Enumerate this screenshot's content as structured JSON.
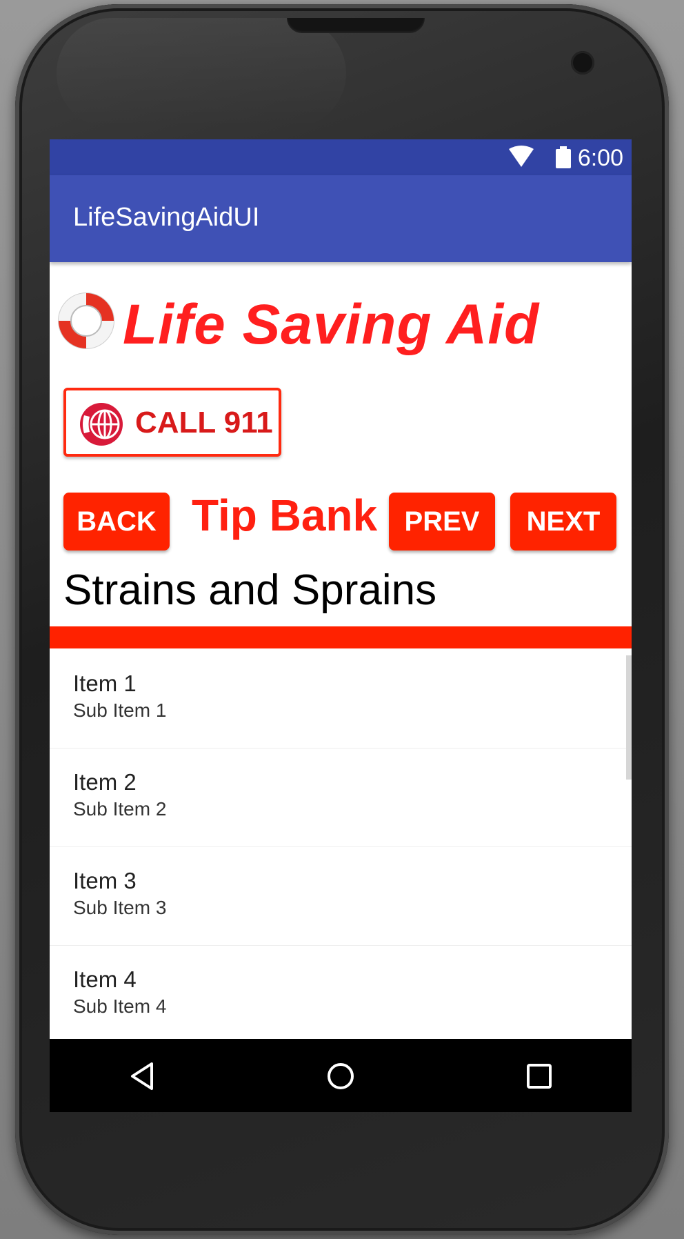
{
  "status_bar": {
    "time": "6:00",
    "icons": [
      "wifi-icon",
      "battery-icon"
    ]
  },
  "app_bar": {
    "title": "LifeSavingAidUI"
  },
  "header": {
    "logo_text": "Life Saving Aid",
    "logo_icon": "lifebuoy-icon"
  },
  "call_button": {
    "label": "CALL 911",
    "icon": "globe-phone-icon"
  },
  "nav": {
    "back_label": "BACK",
    "title": "Tip Bank",
    "prev_label": "PREV",
    "next_label": "NEXT"
  },
  "tip": {
    "title": "Strains and Sprains"
  },
  "list": {
    "items": [
      {
        "title": "Item 1",
        "subtitle": "Sub Item 1"
      },
      {
        "title": "Item 2",
        "subtitle": "Sub Item 2"
      },
      {
        "title": "Item 3",
        "subtitle": "Sub Item 3"
      },
      {
        "title": "Item 4",
        "subtitle": "Sub Item 4"
      }
    ]
  },
  "system_nav": {
    "icons": [
      "back-triangle-icon",
      "home-circle-icon",
      "recents-square-icon"
    ]
  },
  "colors": {
    "primary": "#3f51b5",
    "primary_dark": "#3143a4",
    "accent_red": "#ff2200",
    "logo_red": "#ff1f1f"
  }
}
